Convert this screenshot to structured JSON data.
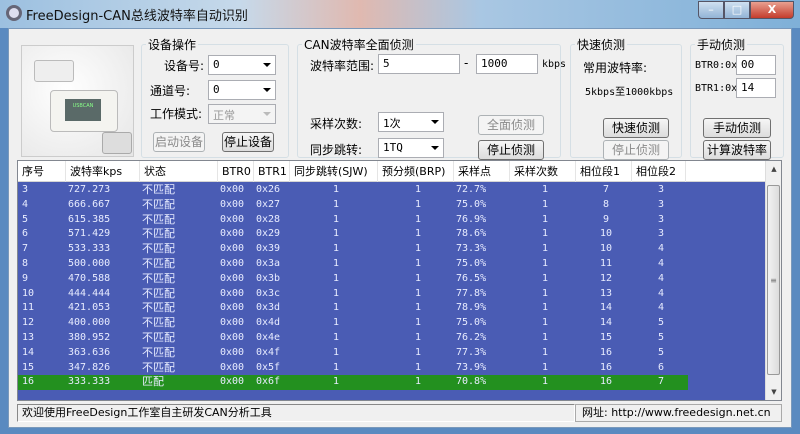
{
  "window": {
    "title": "FreeDesign-CAN总线波特率自动识别",
    "min": "–",
    "max": "□",
    "close": "X"
  },
  "device": {
    "title": "设备操作",
    "device_no_label": "设备号:",
    "device_no": "0",
    "channel_label": "通道号:",
    "channel": "0",
    "mode_label": "工作模式:",
    "mode": "正常",
    "start": "启动设备",
    "stop": "停止设备",
    "photo_text": "USBCAN"
  },
  "full": {
    "title": "CAN波特率全面侦测",
    "range_label": "波特率范围:",
    "range_from": "5",
    "dash": "-",
    "range_to": "1000",
    "unit": "kbps",
    "samples_label": "采样次数:",
    "samples": "1次",
    "sjw_label": "同步跳转:",
    "sjw": "1TQ",
    "start": "全面侦测",
    "stop": "停止侦测"
  },
  "quick": {
    "title": "快速侦测",
    "common_label": "常用波特率:",
    "range": "5kbps至1000kbps",
    "start": "快速侦测",
    "stop": "停止侦测"
  },
  "manual": {
    "title": "手动侦测",
    "btr0_label": "BTR0:0x",
    "btr0": "00",
    "btr1_label": "BTR1:0x",
    "btr1": "14",
    "detect": "手动侦测",
    "calc": "计算波特率"
  },
  "table": {
    "columns": [
      "序号",
      "波特率kps",
      "状态",
      "BTR0",
      "BTR1",
      "同步跳转(SJW)",
      "预分频(BRP)",
      "采样点",
      "采样次数",
      "相位段1",
      "相位段2"
    ],
    "rows": [
      [
        "3",
        "727.273",
        "不匹配",
        "0x00",
        "0x26",
        "1",
        "1",
        "72.7%",
        "1",
        "7",
        "3"
      ],
      [
        "4",
        "666.667",
        "不匹配",
        "0x00",
        "0x27",
        "1",
        "1",
        "75.0%",
        "1",
        "8",
        "3"
      ],
      [
        "5",
        "615.385",
        "不匹配",
        "0x00",
        "0x28",
        "1",
        "1",
        "76.9%",
        "1",
        "9",
        "3"
      ],
      [
        "6",
        "571.429",
        "不匹配",
        "0x00",
        "0x29",
        "1",
        "1",
        "78.6%",
        "1",
        "10",
        "3"
      ],
      [
        "7",
        "533.333",
        "不匹配",
        "0x00",
        "0x39",
        "1",
        "1",
        "73.3%",
        "1",
        "10",
        "4"
      ],
      [
        "8",
        "500.000",
        "不匹配",
        "0x00",
        "0x3a",
        "1",
        "1",
        "75.0%",
        "1",
        "11",
        "4"
      ],
      [
        "9",
        "470.588",
        "不匹配",
        "0x00",
        "0x3b",
        "1",
        "1",
        "76.5%",
        "1",
        "12",
        "4"
      ],
      [
        "10",
        "444.444",
        "不匹配",
        "0x00",
        "0x3c",
        "1",
        "1",
        "77.8%",
        "1",
        "13",
        "4"
      ],
      [
        "11",
        "421.053",
        "不匹配",
        "0x00",
        "0x3d",
        "1",
        "1",
        "78.9%",
        "1",
        "14",
        "4"
      ],
      [
        "12",
        "400.000",
        "不匹配",
        "0x00",
        "0x4d",
        "1",
        "1",
        "75.0%",
        "1",
        "14",
        "5"
      ],
      [
        "13",
        "380.952",
        "不匹配",
        "0x00",
        "0x4e",
        "1",
        "1",
        "76.2%",
        "1",
        "15",
        "5"
      ],
      [
        "14",
        "363.636",
        "不匹配",
        "0x00",
        "0x4f",
        "1",
        "1",
        "77.3%",
        "1",
        "16",
        "5"
      ],
      [
        "15",
        "347.826",
        "不匹配",
        "0x00",
        "0x5f",
        "1",
        "1",
        "73.9%",
        "1",
        "16",
        "6"
      ],
      [
        "16",
        "333.333",
        "匹配",
        "0x00",
        "0x6f",
        "1",
        "1",
        "70.8%",
        "1",
        "16",
        "7"
      ]
    ],
    "match_color": "#23901f",
    "row_color": "#4a5cb4"
  },
  "status": {
    "welcome": "欢迎使用FreeDesign工作室自主研发CAN分析工具",
    "url": "网址: http://www.freedesign.net.cn"
  }
}
